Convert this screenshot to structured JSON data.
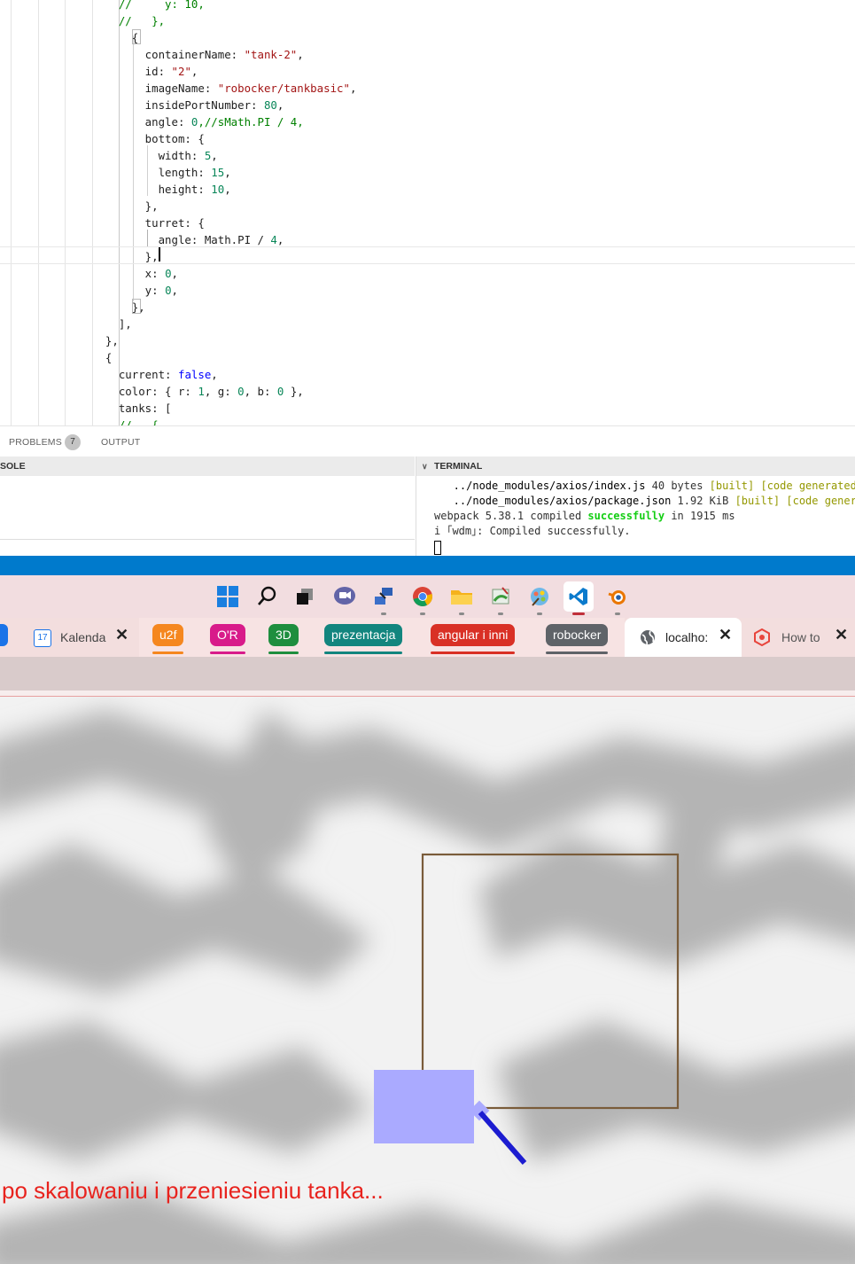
{
  "editor": {
    "lines": [
      [
        {
          "t": "    //     y: 10,",
          "c": "cm"
        }
      ],
      [
        {
          "t": "    //   },",
          "c": "cm"
        }
      ],
      [
        {
          "t": "      {"
        }
      ],
      [
        {
          "t": "        containerName: "
        },
        {
          "t": "\"tank-2\"",
          "c": "str"
        },
        {
          "t": ","
        }
      ],
      [
        {
          "t": "        id: "
        },
        {
          "t": "\"2\"",
          "c": "str"
        },
        {
          "t": ","
        }
      ],
      [
        {
          "t": "        imageName: "
        },
        {
          "t": "\"robocker/tankbasic\"",
          "c": "str"
        },
        {
          "t": ","
        }
      ],
      [
        {
          "t": "        insidePortNumber: "
        },
        {
          "t": "80",
          "c": "num"
        },
        {
          "t": ","
        }
      ],
      [
        {
          "t": "        angle: "
        },
        {
          "t": "0",
          "c": "num"
        },
        {
          "t": ",//sMath.PI / 4,",
          "c": "cm"
        }
      ],
      [
        {
          "t": "        bottom: {"
        }
      ],
      [
        {
          "t": "          width: "
        },
        {
          "t": "5",
          "c": "num"
        },
        {
          "t": ","
        }
      ],
      [
        {
          "t": "          length: "
        },
        {
          "t": "15",
          "c": "num"
        },
        {
          "t": ","
        }
      ],
      [
        {
          "t": "          height: "
        },
        {
          "t": "10",
          "c": "num"
        },
        {
          "t": ","
        }
      ],
      [
        {
          "t": "        },"
        }
      ],
      [
        {
          "t": "        turret: {"
        }
      ],
      [
        {
          "t": "          angle: Math.PI / "
        },
        {
          "t": "4",
          "c": "num"
        },
        {
          "t": ","
        }
      ],
      [
        {
          "t": "        },"
        }
      ],
      [
        {
          "t": "        x: "
        },
        {
          "t": "0",
          "c": "num"
        },
        {
          "t": ","
        }
      ],
      [
        {
          "t": "        y: "
        },
        {
          "t": "0",
          "c": "num"
        },
        {
          "t": ","
        }
      ],
      [
        {
          "t": "      },"
        }
      ],
      [
        {
          "t": "    ],"
        }
      ],
      [
        {
          "t": "  },"
        }
      ],
      [
        {
          "t": "  {"
        }
      ],
      [
        {
          "t": "    current: "
        },
        {
          "t": "false",
          "c": "kw"
        },
        {
          "t": ","
        }
      ],
      [
        {
          "t": "    color: { r: "
        },
        {
          "t": "1",
          "c": "num"
        },
        {
          "t": ", g: "
        },
        {
          "t": "0",
          "c": "num"
        },
        {
          "t": ", b: "
        },
        {
          "t": "0",
          "c": "num"
        },
        {
          "t": " },"
        }
      ],
      [
        {
          "t": "    tanks: ["
        }
      ],
      [
        {
          "t": "    //   {",
          "c": "cm"
        }
      ]
    ]
  },
  "panel": {
    "tabs": [
      "PROBLEMS",
      "OUTPUT"
    ],
    "problems_count": "7",
    "console_header": "SOLE",
    "terminal_header": "TERMINAL",
    "terminal_lines": [
      [
        {
          "t": "   ../node_modules/axios/index.js ",
          "c": "bold"
        },
        {
          "t": "40 bytes "
        },
        {
          "t": "[built] [code generated]",
          "c": "y"
        }
      ],
      [
        {
          "t": "   ../node_modules/axios/package.json ",
          "c": "bold"
        },
        {
          "t": "1.92 KiB "
        },
        {
          "t": "[built] [code generated]",
          "c": "y"
        }
      ],
      [
        {
          "t": "webpack 5.38.1 compiled "
        },
        {
          "t": "successfully",
          "c": "g"
        },
        {
          "t": " in 1915 ms"
        }
      ],
      [
        {
          "t": "i ｢wdm｣: Compiled successfully."
        }
      ]
    ]
  },
  "taskbar": {
    "icons": [
      "windows-start-icon",
      "search-icon",
      "task-view-icon",
      "teams-chat-icon",
      "network-app-icon",
      "chrome-icon",
      "file-explorer-icon",
      "paint-app-icon",
      "paint3d-icon",
      "vscode-icon",
      "blender-icon"
    ]
  },
  "tabs": {
    "calendar_tab": "Kalenda",
    "groups": [
      {
        "label": "u2f",
        "color": "#f5871f"
      },
      {
        "label": "O'R",
        "color": "#d81b8a"
      },
      {
        "label": "3D",
        "color": "#1e8e3e"
      },
      {
        "label": "prezentacja",
        "color": "#12857e"
      },
      {
        "label": "angular i inni",
        "color": "#d93025"
      },
      {
        "label": "robocker",
        "color": "#5f6368"
      }
    ],
    "active_tab": "localho:",
    "howto_tab": "How to"
  },
  "caption": "po skalowaniu i przeniesieniu tanka..."
}
